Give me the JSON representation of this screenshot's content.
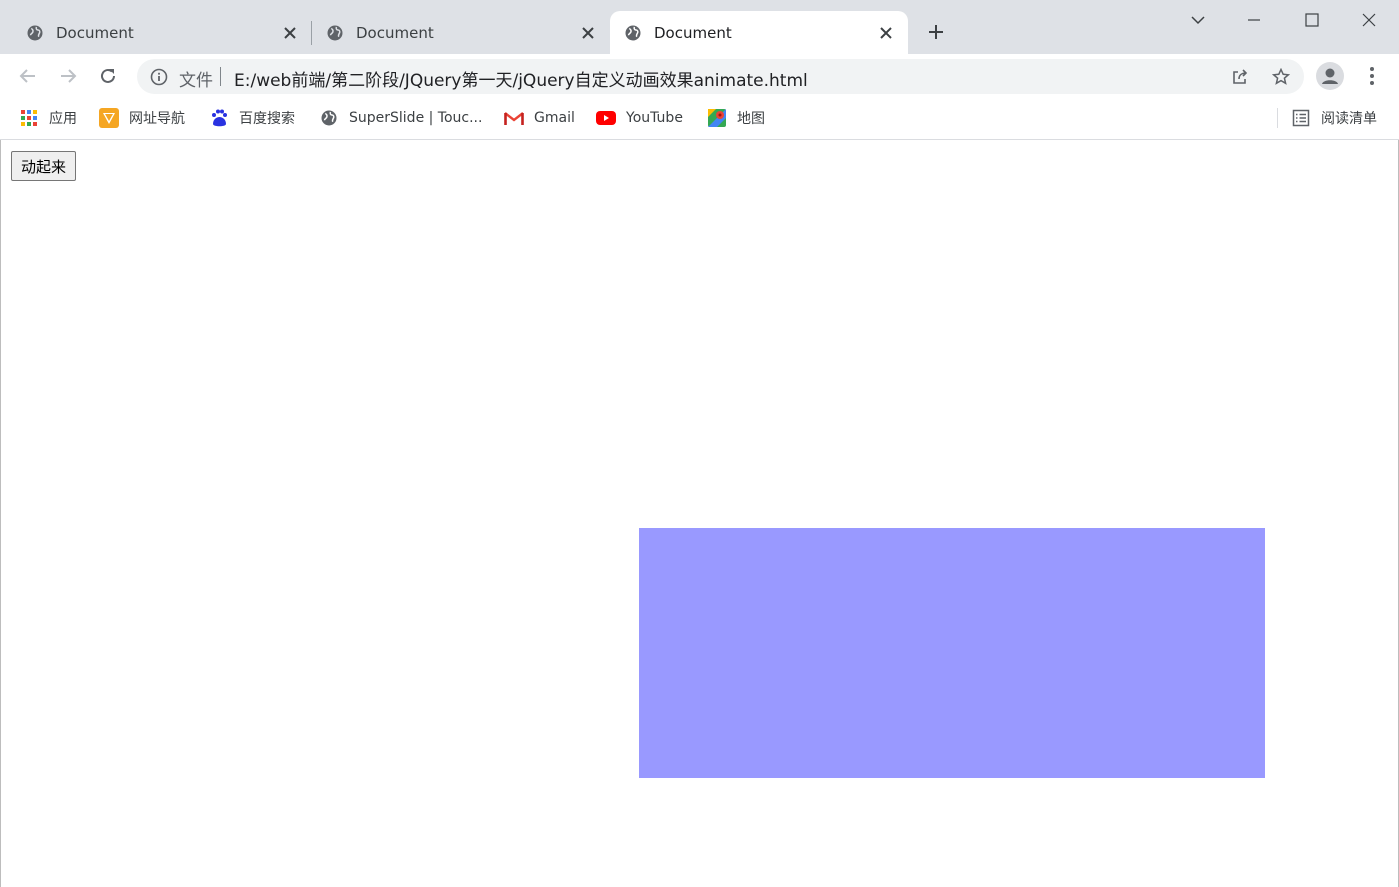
{
  "tabs": [
    {
      "title": "Document",
      "active": false
    },
    {
      "title": "Document",
      "active": false
    },
    {
      "title": "Document",
      "active": true
    }
  ],
  "toolbar": {
    "url_scheme_label": "文件",
    "url": "E:/web前端/第二阶段/JQuery第一天/jQuery自定义动画效果animate.html"
  },
  "bookmarks": [
    {
      "label": "应用",
      "icon": "apps-grid-icon"
    },
    {
      "label": "网址导航",
      "icon": "nav-arrow-icon"
    },
    {
      "label": "百度搜索",
      "icon": "baidu-paw-icon"
    },
    {
      "label": "SuperSlide | Touc...",
      "icon": "globe-icon"
    },
    {
      "label": "Gmail",
      "icon": "gmail-icon"
    },
    {
      "label": "YouTube",
      "icon": "youtube-icon"
    },
    {
      "label": "地图",
      "icon": "maps-pin-icon"
    }
  ],
  "reading_list": {
    "label": "阅读清单",
    "icon": "reading-list-icon"
  },
  "page": {
    "button_label": "动起来",
    "box_color": "#9999ff"
  },
  "colors": {
    "tabstrip_bg": "#dee1e6",
    "omnibox_bg": "#f1f3f4",
    "box": "#9999ff"
  }
}
